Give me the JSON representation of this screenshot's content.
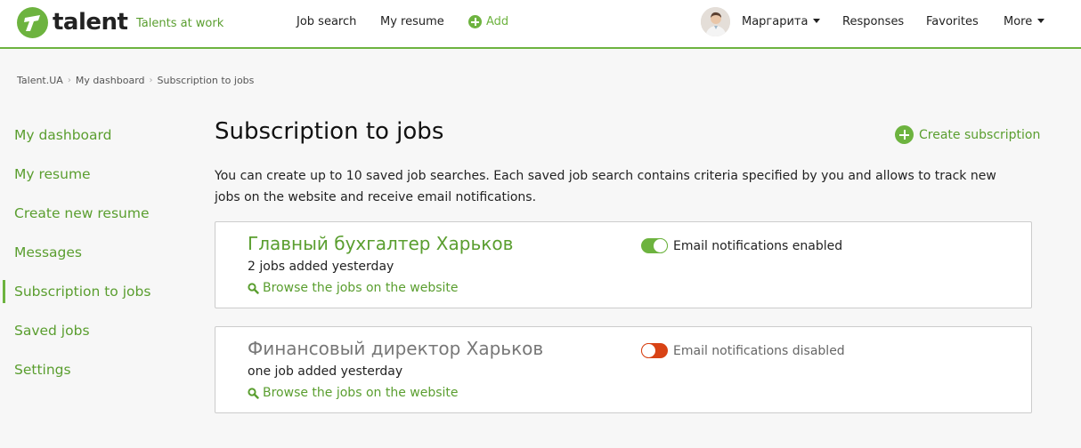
{
  "header": {
    "logo_text": "talent",
    "tagline": "Talents at work",
    "nav": {
      "job_search": "Job search",
      "my_resume": "My resume",
      "add": "Add"
    },
    "user_name": "Маргарита",
    "responses": "Responses",
    "favorites": "Favorites",
    "more": "More"
  },
  "breadcrumb": [
    "Talent.UA",
    "My dashboard",
    "Subscription to jobs"
  ],
  "sidebar": {
    "items": [
      {
        "label": "My dashboard"
      },
      {
        "label": "My resume"
      },
      {
        "label": "Create new resume"
      },
      {
        "label": "Messages"
      },
      {
        "label": "Subscription to jobs"
      },
      {
        "label": "Saved jobs"
      },
      {
        "label": "Settings"
      }
    ],
    "active_index": 4
  },
  "main": {
    "title": "Subscription to jobs",
    "create_label": "Create subscription",
    "intro": "You can create up to 10 saved job searches. Each saved job search contains criteria specified by you and allows to track new jobs on the website and receive email notifications.",
    "subscriptions": [
      {
        "title": "Главный бухгалтер Харьков",
        "count": "2 jobs added yesterday",
        "link": "Browse the jobs on the website",
        "notifications": true,
        "toggle_label": "Email notifications enabled"
      },
      {
        "title": "Финансовый директор Харьков",
        "count": "one job added yesterday",
        "link": "Browse the jobs on the website",
        "notifications": false,
        "toggle_label": "Email notifications disabled"
      }
    ]
  },
  "colors": {
    "brand_green": "#6db33f",
    "link_green": "#5a9e2f",
    "toggle_off": "#d84315"
  },
  "icons": [
    "talent-logo-icon",
    "plus-circle-icon",
    "caret-down-icon",
    "search-icon",
    "toggle-switch-icon"
  ]
}
